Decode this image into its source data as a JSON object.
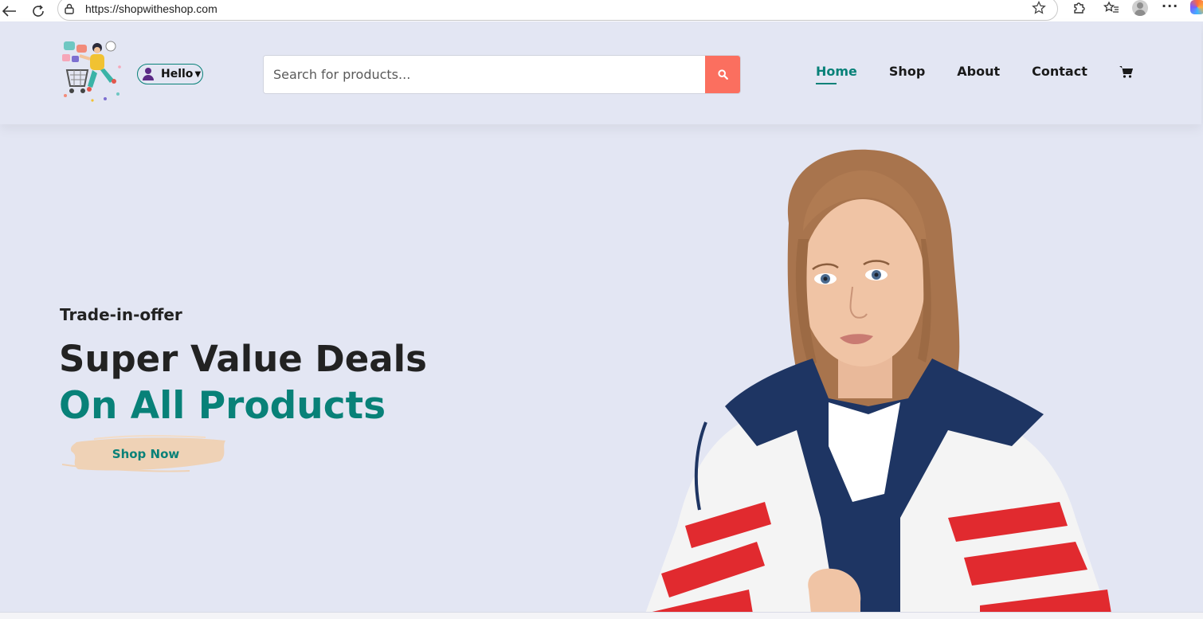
{
  "browser": {
    "url": "https://shopwitheshop.com",
    "icons": [
      "back-icon",
      "refresh-icon",
      "lock-icon",
      "star-icon",
      "extensions-icon",
      "favorites-icon",
      "profile-icon",
      "more-icon",
      "copilot-icon"
    ]
  },
  "header": {
    "user_menu_label": "Hello",
    "search": {
      "placeholder": "Search for products..."
    },
    "nav": [
      {
        "label": "Home",
        "active": true
      },
      {
        "label": "Shop",
        "active": false
      },
      {
        "label": "About",
        "active": false
      },
      {
        "label": "Contact",
        "active": false
      }
    ],
    "cart_icon": "cart-icon"
  },
  "hero": {
    "kicker": "Trade-in-offer",
    "title": "Super Value Deals",
    "subtitle": "On All Products",
    "button_label": "Shop Now"
  },
  "colors": {
    "background": "#e3e6f3",
    "accent": "#088178",
    "search_button": "#fb6f5f",
    "button_brush": "#efd2b6",
    "text_dark": "#222222"
  }
}
